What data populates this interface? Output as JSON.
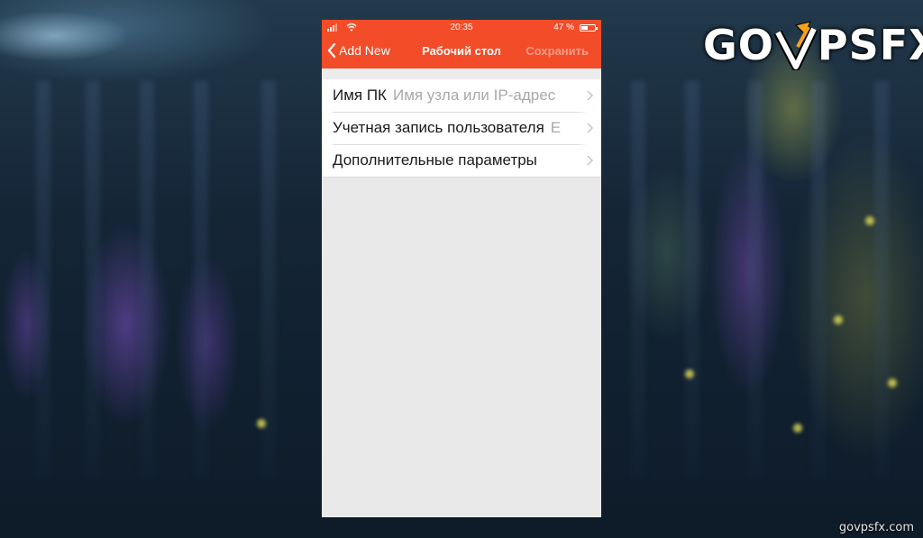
{
  "status_bar": {
    "time": "20:35",
    "battery": "47 %"
  },
  "navbar": {
    "back_label": "Add New",
    "title": "Рабочий стол",
    "save_label": "Сохранить"
  },
  "rows": [
    {
      "label": "Имя ПК",
      "value": "Имя узла или IP-адрес"
    },
    {
      "label": "Учетная запись пользователя",
      "value": "Е"
    },
    {
      "label": "Дополнительные параметры",
      "value": ""
    }
  ],
  "logo": {
    "text_left": "GO",
    "text_right": "PSFX"
  },
  "watermark": "govpsfx.com",
  "colors": {
    "accent": "#f24c28",
    "background": "#e9e9e9",
    "placeholder": "#a8a8a8"
  }
}
